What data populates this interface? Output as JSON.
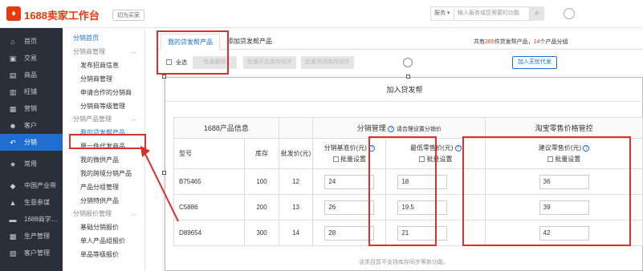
{
  "header": {
    "brand": "1688卖家工作台",
    "switch": "切为买家",
    "service": "服务 ▾",
    "search_placeholder": "输入服务或您需要的功能"
  },
  "left_nav": [
    {
      "label": "首页",
      "icon": "home-icon",
      "glyph": "⌂"
    },
    {
      "label": "交易",
      "icon": "trade-icon",
      "glyph": "▣"
    },
    {
      "label": "商品",
      "icon": "goods-icon",
      "glyph": "▤"
    },
    {
      "label": "旺铺",
      "icon": "shop-icon",
      "glyph": "▥"
    },
    {
      "label": "营销",
      "icon": "marketing-icon",
      "glyph": "▦"
    },
    {
      "label": "客户",
      "icon": "customer-icon",
      "glyph": "☻"
    },
    {
      "label": "分销",
      "icon": "distribution-icon",
      "glyph": "↶"
    },
    {
      "label": "常用",
      "icon": "star-icon",
      "glyph": "★"
    },
    {
      "label": "中国产业带",
      "icon": "industry-icon",
      "glyph": "◆"
    },
    {
      "label": "生意参谋",
      "icon": "business-icon",
      "glyph": "▲"
    },
    {
      "label": "1688商学…",
      "icon": "school-icon",
      "glyph": "▬"
    },
    {
      "label": "生产管理",
      "icon": "production-icon",
      "glyph": "▩"
    },
    {
      "label": "客户管理",
      "icon": "crm-icon",
      "glyph": "▧"
    }
  ],
  "sub_nav": {
    "top": "分销首页",
    "groups": [
      {
        "title": "分销商管理",
        "items": [
          "发布招商信息",
          "分销商管理",
          "申请合作的分销商",
          "分销商等级管理"
        ]
      },
      {
        "title": "分销产品管理",
        "items": [
          "我的贷发帮产品",
          "原一件代发商品",
          "我的微供产品",
          "我的跨境分销产品",
          "产品分组管理",
          "分销特供产品"
        ]
      },
      {
        "title": "分销报价管理",
        "items": [
          "基础分销报价",
          "单人产品组报价",
          "单品等级报价"
        ]
      }
    ]
  },
  "tabs": [
    "我的贷发帮产品",
    "添加贷发帮产品"
  ],
  "summary": {
    "pre": "共有",
    "count": "265",
    "mid": "件贷发帮产品，",
    "count2": "14",
    "post": "个产品分组"
  },
  "toolbar": {
    "select_all": "全选",
    "add_free": "加入无忧代发",
    "b1": "批量删除",
    "b2": "批量开启库存同步",
    "b3": "批量关闭库存同步"
  },
  "modal": {
    "title": "加入贷发帮",
    "group_headers": [
      "1688产品信息",
      "分销管理",
      "淘宝零售价格管控"
    ],
    "dist_hint": "请合理设置分销价",
    "columns": {
      "model": "型号",
      "stock": "库存",
      "wholesale": "批发价(元)",
      "base": "分销基准价(元)",
      "min": "最低零售价(元)",
      "suggest": "建议零售价(元)",
      "batch": "批量设置"
    },
    "rows": [
      {
        "model": "B75465",
        "stock": "100",
        "wholesale": "12",
        "base": "24",
        "min": "18",
        "suggest": "36"
      },
      {
        "model": "C5886",
        "stock": "200",
        "wholesale": "13",
        "base": "26",
        "min": "19.5",
        "suggest": "39"
      },
      {
        "model": "D89654",
        "stock": "300",
        "wholesale": "14",
        "base": "28",
        "min": "21",
        "suggest": "42"
      }
    ],
    "note": "该类目暂不支持库存同步等新功能。"
  },
  "colors": {
    "accent": "#1e6fd1",
    "brand": "#e8380d",
    "highlight": "#d9312a",
    "nav_bg": "#2b2f3a"
  }
}
